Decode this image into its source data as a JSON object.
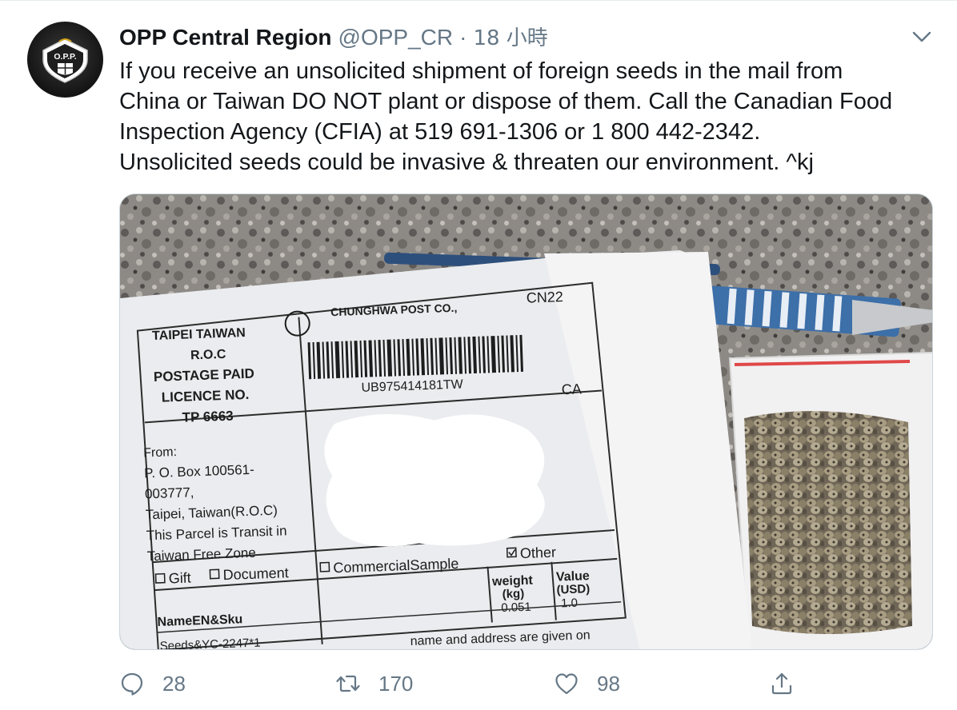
{
  "tweet": {
    "display_name": "OPP Central Region",
    "handle": "@OPP_CR",
    "separator": "·",
    "time": "18 小時",
    "text": "If you receive an unsolicited shipment of foreign seeds in the mail from\nChina or Taiwan DO NOT plant or dispose of them. Call the Canadian Food\nInspection Agency (CFIA) at 519 691-1306 or 1 800 442-2342.\nUnsolicited seeds could be invasive & threaten our environment. ^kj",
    "avatar_badge_text": "O.P.P."
  },
  "photo": {
    "sender_lines": [
      "TAIPEI TAIWAN",
      "R.O.C",
      "POSTAGE PAID",
      "LICENCE NO.",
      "TP 6663"
    ],
    "post_co": "CHUNGHWA POST CO.,",
    "form_code": "CN22",
    "tracking": "UB975414181TW",
    "dest_country": "CA",
    "from_lines": [
      "From:",
      "P. O. Box 100561-",
      "003777,",
      "Taipei, Taiwan(R.O.C)",
      "This Parcel is Transit in",
      "Taiwan Free Zone"
    ],
    "categories": [
      "Gift",
      "Document",
      "CommercialSample",
      "Other"
    ],
    "weight_label": [
      "weight",
      "(kg)"
    ],
    "value_label": [
      "Value",
      "(USD)"
    ],
    "name_label": "NameEN&Sku",
    "item": "Seeds&YC-2247*1",
    "weight": "0.051",
    "value": "1.0",
    "footer": "name and address are given on"
  },
  "actions": {
    "replies": "28",
    "retweets": "170",
    "likes": "98"
  },
  "icons": {
    "reply": "reply-icon",
    "retweet": "retweet-icon",
    "like": "heart-icon",
    "share": "share-icon",
    "menu": "chevron-down-icon"
  },
  "colors": {
    "secondary_text": "#657786",
    "primary_text": "#14171a"
  }
}
